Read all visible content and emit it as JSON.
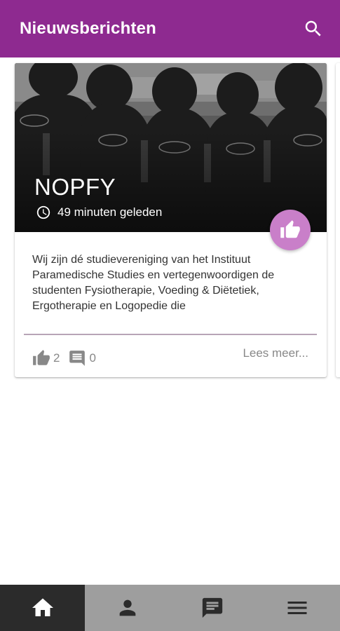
{
  "header": {
    "title": "Nieuwsberichten",
    "search_icon": "search-icon"
  },
  "card": {
    "title": "NOPFY",
    "time": "49 minuten geleden",
    "excerpt": "Wij zijn dé studievereniging van het Instituut Paramedische Studies en vertegenwoordigen de studenten Fysiotherapie, Voeding & Diëtetiek, Ergotherapie en Logopedie die",
    "likes": "2",
    "comments": "0",
    "read_more": "Lees meer...",
    "shirt_text": "NOPFY",
    "image_desc": "group-photo-icon"
  },
  "bottom_nav": {
    "items": [
      {
        "icon": "home-icon",
        "active": true
      },
      {
        "icon": "person-icon",
        "active": false
      },
      {
        "icon": "chat-icon",
        "active": false
      },
      {
        "icon": "menu-icon",
        "active": false
      }
    ]
  },
  "colors": {
    "primary": "#8e2a90",
    "fab": "#c97fc9",
    "nav_bg": "#9e9e9e",
    "nav_active": "#2b2b2b"
  }
}
